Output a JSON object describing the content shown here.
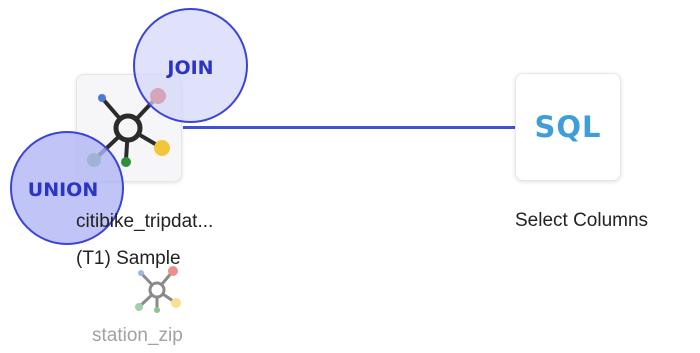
{
  "nodes": {
    "source": {
      "label": "citibike_tripdat...",
      "icon": "data-source-hub-icon"
    },
    "sample": {
      "label": "(T1) Sample"
    },
    "sql": {
      "icon_text": "SQL",
      "label": "Select Columns"
    },
    "lookup": {
      "label": "station_zip",
      "icon": "data-source-hub-icon"
    }
  },
  "drop_targets": {
    "join": "JOIN",
    "union": "UNION"
  },
  "colors": {
    "connector": "#3f51d6",
    "bubble_border": "#3a45d8",
    "sql_blue": "#3d9ed9",
    "node_red": "#d9352b",
    "node_yellow": "#f3c53a",
    "node_green": "#5aa862",
    "node_blue": "#4a7bd1"
  }
}
